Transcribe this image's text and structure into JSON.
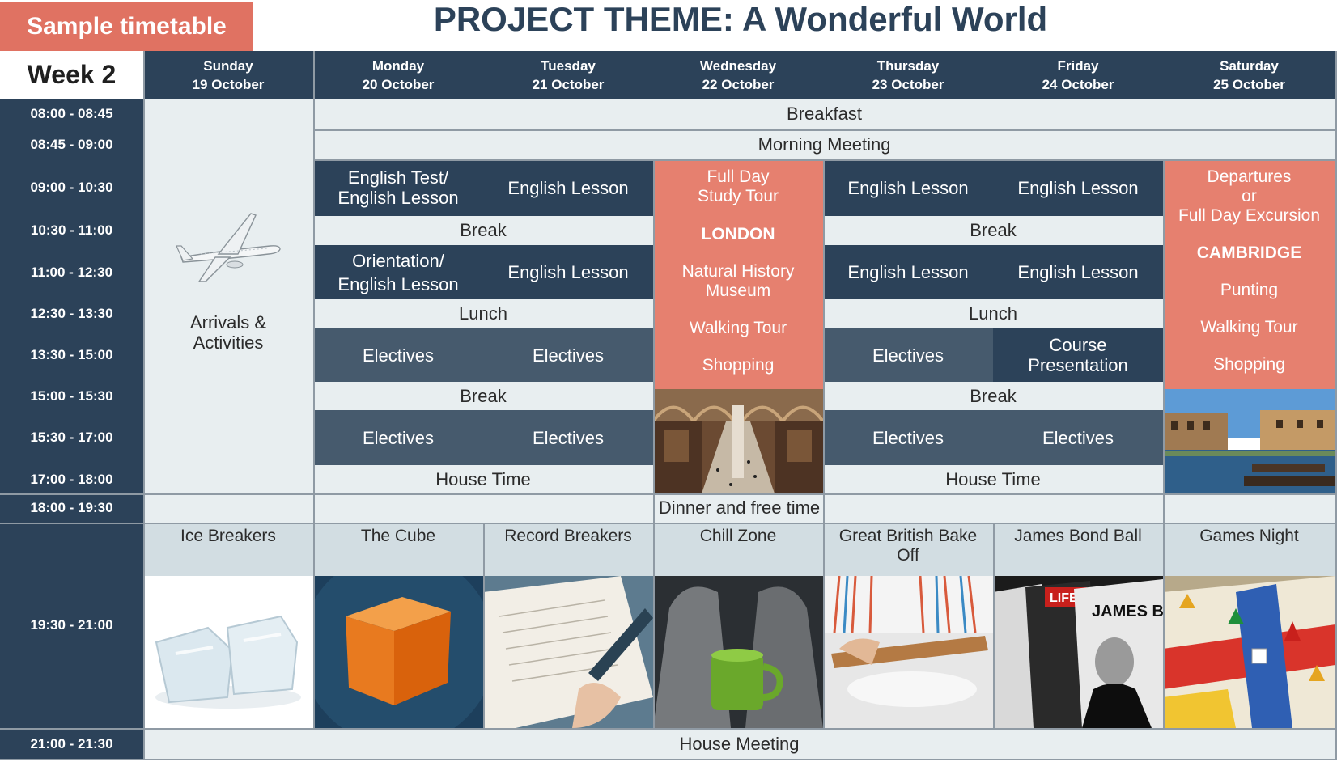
{
  "badge": "Sample timetable",
  "theme_title": "PROJECT THEME: A Wonderful World",
  "week_label": "Week 2",
  "days": [
    {
      "name": "Sunday",
      "date": "19 October"
    },
    {
      "name": "Monday",
      "date": "20 October"
    },
    {
      "name": "Tuesday",
      "date": "21 October"
    },
    {
      "name": "Wednesday",
      "date": "22 October"
    },
    {
      "name": "Thursday",
      "date": "23 October"
    },
    {
      "name": "Friday",
      "date": "24 October"
    },
    {
      "name": "Saturday",
      "date": "25 October"
    }
  ],
  "times": [
    "08:00 - 08:45",
    "08:45 - 09:00",
    "09:00 - 10:30",
    "10:30 - 11:00",
    "11:00 - 12:30",
    "12:30 - 13:30",
    "13:30 - 15:00",
    "15:00 - 15:30",
    "15:30 - 17:00",
    "17:00 - 18:00",
    "18:00 - 19:30",
    "19:30 - 21:00",
    "21:00 - 21:30"
  ],
  "sunday": {
    "arrivals_line1": "Arrivals &",
    "arrivals_line2": "Activities"
  },
  "shared": {
    "breakfast": "Breakfast",
    "morning_meeting": "Morning Meeting",
    "dinner": "Dinner and free time",
    "house_meeting": "House Meeting"
  },
  "mon_tue": {
    "mon_9_l1": "English Test/",
    "mon_9_l2": "English Lesson",
    "tue_9": "English Lesson",
    "break1": "Break",
    "mon_11_l1": "Orientation/",
    "mon_11_l2": "English Lesson",
    "tue_11": "English Lesson",
    "lunch": "Lunch",
    "mon_1330": "Electives",
    "tue_1330": "Electives",
    "break2": "Break",
    "mon_1530": "Electives",
    "tue_1530": "Electives",
    "house_time": "House Time"
  },
  "wednesday": {
    "line1": "Full Day",
    "line2": "Study Tour",
    "city": "LONDON",
    "act1_l1": "Natural History",
    "act1_l2": "Museum",
    "act2": "Walking Tour",
    "act3": "Shopping"
  },
  "thu_fri": {
    "thu_9": "English Lesson",
    "fri_9": "English Lesson",
    "break1": "Break",
    "thu_11": "English Lesson",
    "fri_11": "English Lesson",
    "lunch": "Lunch",
    "thu_1330": "Electives",
    "fri_1330_l1": "Course",
    "fri_1330_l2": "Presentation",
    "break2": "Break",
    "thu_1530": "Electives",
    "fri_1530": "Electives",
    "house_time": "House Time"
  },
  "saturday": {
    "line1": "Departures",
    "line2": "or",
    "line3": "Full Day Excursion",
    "city": "CAMBRIDGE",
    "act1": "Punting",
    "act2": "Walking Tour",
    "act3": "Shopping"
  },
  "evening": [
    "Ice Breakers",
    "The Cube",
    "Record Breakers",
    "Chill Zone",
    "Great British Bake Off",
    "James Bond Ball",
    "Games Night"
  ],
  "magazine_text": {
    "life": "LIFE",
    "james_bond": "JAMES BOND"
  },
  "colors": {
    "navy": "#2c4259",
    "slate": "#465a6d",
    "salmon": "#e6806f",
    "light": "#e8eef0",
    "evening": "#d2dde2"
  }
}
